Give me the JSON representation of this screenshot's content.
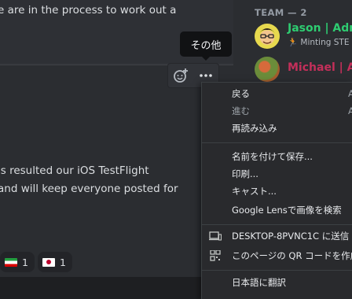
{
  "chat": {
    "top_message_line": "e are in the process to work out a",
    "bottom_message_line1": "is resulted our iOS TestFlight",
    "bottom_message_line2": "and will keep everyone posted for",
    "reactions": [
      {
        "flag": "iran-flag",
        "count": "1"
      },
      {
        "flag": "japan-flag",
        "count": "1"
      }
    ]
  },
  "tooltip": "その他",
  "toolbar": {
    "add_reaction_icon": "add-reaction-icon",
    "more_icon": "more-icon"
  },
  "members": {
    "header": "TEAM — 2",
    "items": [
      {
        "name": "Jason | Adm",
        "status": "Minting STE",
        "name_color": "#2ecc71",
        "status_icon": "🏃"
      },
      {
        "name": "Michael | Ad",
        "status": "",
        "name_color": "#c42f5a"
      }
    ]
  },
  "context_menu": {
    "items": [
      {
        "label": "戻る",
        "shortcut": "A",
        "disabled": false
      },
      {
        "label": "進む",
        "shortcut": "A",
        "disabled": true
      },
      {
        "label": "再読み込み",
        "disabled": false
      },
      {
        "label": "名前を付けて保存...",
        "disabled": false
      },
      {
        "label": "印刷...",
        "disabled": false
      },
      {
        "label": "キャスト...",
        "disabled": false
      },
      {
        "label": "Google Lensで画像を検索",
        "disabled": false
      },
      {
        "label": "DESKTOP-8PVNC1C に送信",
        "icon": "device-icon",
        "disabled": false
      },
      {
        "label": "このページの QR コードを作成",
        "icon": "qr-code-icon",
        "disabled": false
      },
      {
        "label": "日本語に翻訳",
        "disabled": false
      }
    ]
  }
}
